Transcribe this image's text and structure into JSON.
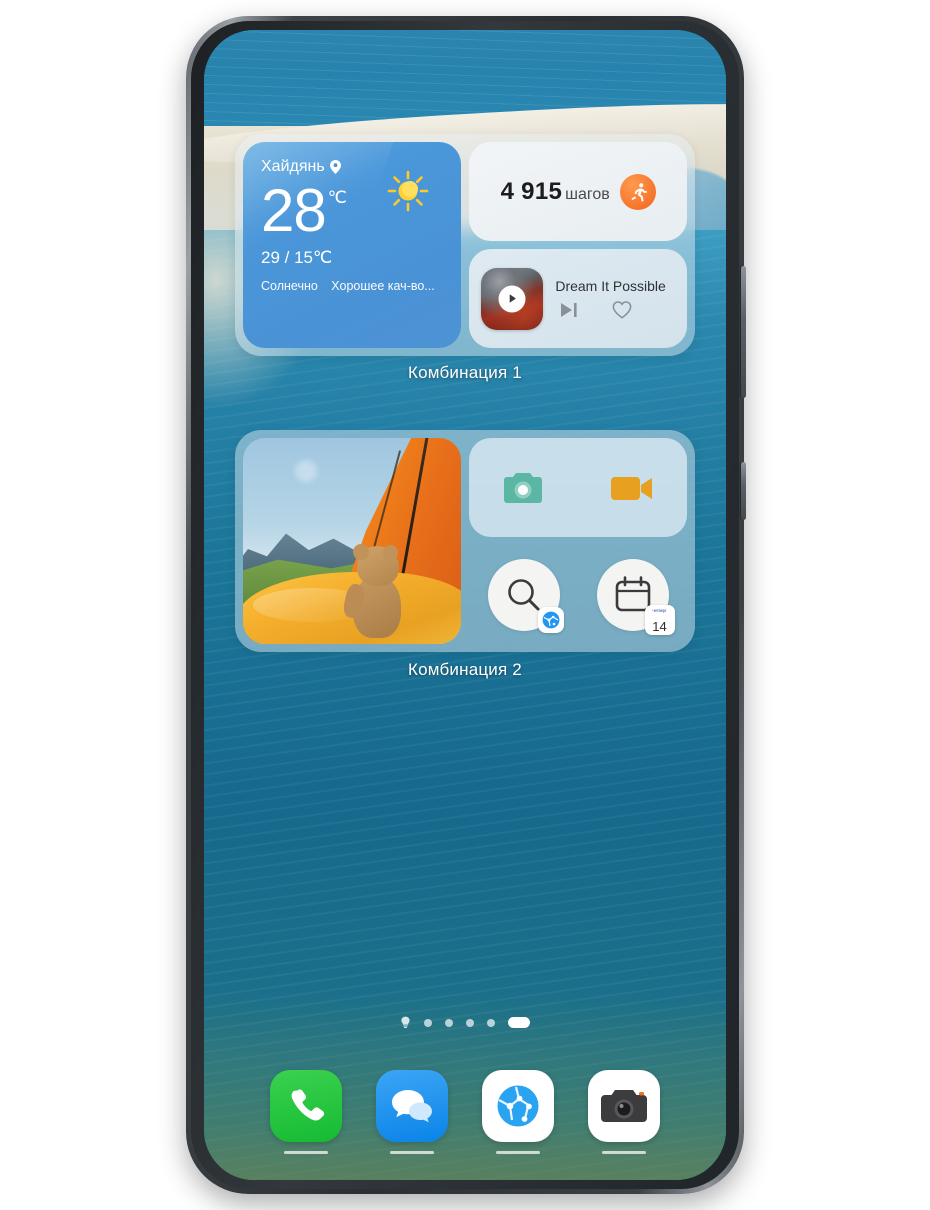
{
  "device": {
    "frame_color": "#2b2f33",
    "side_buttons": [
      {
        "name": "volume-rocker"
      },
      {
        "name": "power-button"
      }
    ]
  },
  "wallpaper": {
    "description": "aerial beach sandbar with teal rippled water",
    "sky_color": "#2683ad",
    "sand_color": "#e3ded0",
    "water_color": "#1b7699"
  },
  "widget_groups": [
    {
      "label": "Комбинация 1",
      "weather": {
        "city": "Хайдянь",
        "location_icon": "location-pin-icon",
        "condition_icon": "sun-icon",
        "temperature": "28",
        "unit": "℃",
        "range": "29 / 15℃",
        "condition": "Солнечно",
        "air_quality": "Хорошее кач-во...",
        "bg_color": "#4a92d6"
      },
      "steps": {
        "count": "4 915",
        "unit": "шагов",
        "icon": "running-person-icon",
        "badge_color": "#f4631e"
      },
      "music": {
        "track": "Dream It Possible",
        "play_icon": "play-icon",
        "next_icon": "skip-next-icon",
        "favorite_icon": "heart-outline-icon"
      }
    },
    {
      "label": "Комбинация 2",
      "photo": {
        "description": "teddy bear in orange tent with mountains and lake"
      },
      "tiles": [
        {
          "icon": "camera-icon",
          "color": "#5bb7a3"
        },
        {
          "icon": "video-camera-icon",
          "color": "#e8a020"
        }
      ],
      "shortcuts": [
        {
          "icon": "search-magnifier-icon",
          "badge_icon": "browser-globe-icon",
          "badge_color": "#2196f3"
        },
        {
          "icon": "calendar-icon",
          "badge_label": "14",
          "badge_top_label": "четверг"
        }
      ]
    }
  ],
  "page_indicator": {
    "items": [
      "lightbulb-icon",
      "dot",
      "dot",
      "dot",
      "dot",
      "active-pill"
    ],
    "active_index": 5
  },
  "dock": {
    "items": [
      {
        "name": "phone",
        "icon": "phone-handset-icon",
        "color": "#16bb33"
      },
      {
        "name": "messages",
        "icon": "chat-bubbles-icon",
        "color": "#0a84e8"
      },
      {
        "name": "browser",
        "icon": "globe-icon",
        "color": "#ffffff"
      },
      {
        "name": "camera",
        "icon": "camera-body-icon",
        "color": "#ffffff"
      }
    ]
  }
}
